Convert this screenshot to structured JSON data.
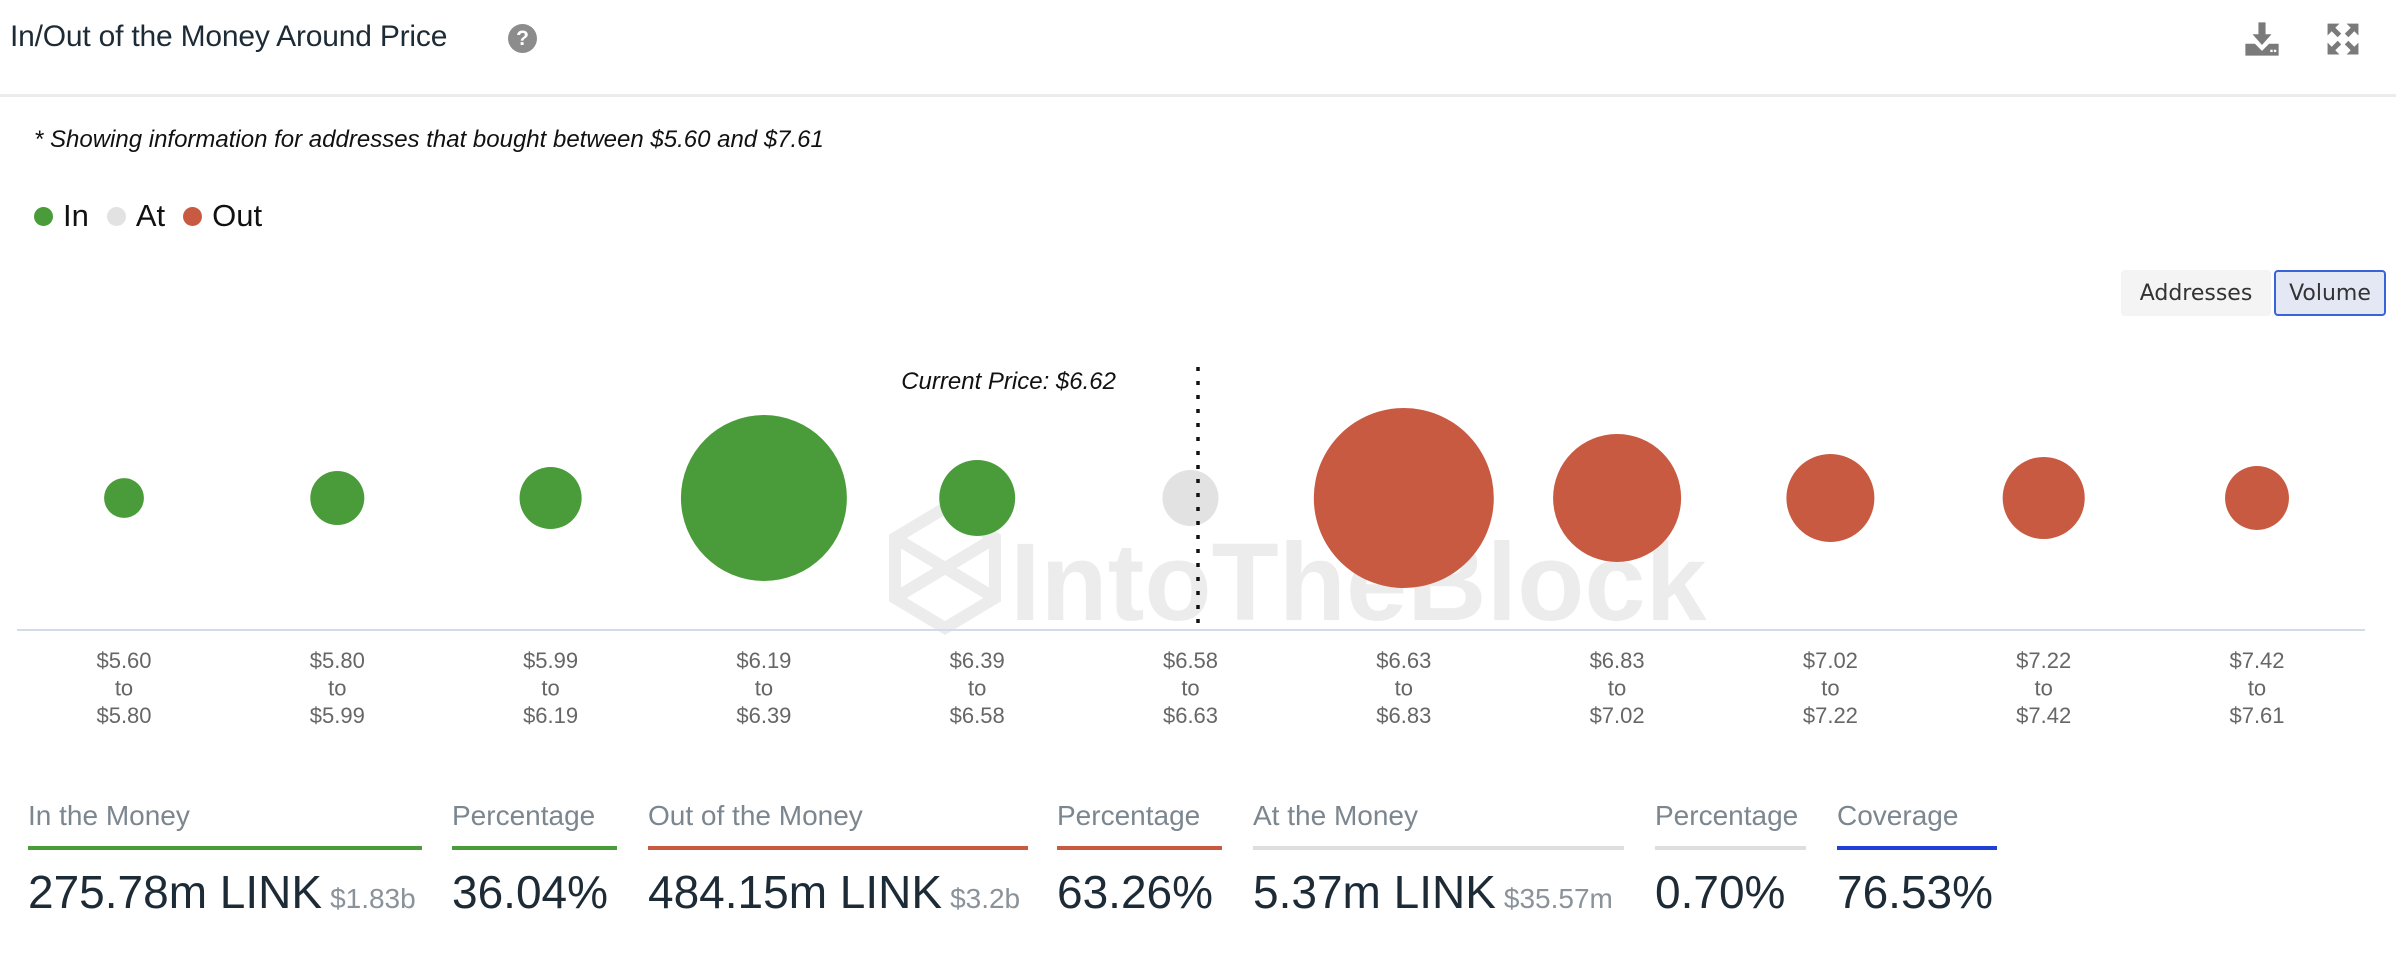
{
  "header": {
    "title": "In/Out of the Money Around Price",
    "help_icon": "question-circle-icon",
    "download_icon": "download-icon",
    "expand_icon": "expand-icon"
  },
  "note": "* Showing information for addresses that bought between $5.60 and $7.61",
  "legend": [
    {
      "label": "In",
      "color": "#4a9c3a"
    },
    {
      "label": "At",
      "color": "#e2e2e2"
    },
    {
      "label": "Out",
      "color": "#c95a42"
    }
  ],
  "toggle": {
    "options": [
      "Addresses",
      "Volume"
    ],
    "selected": "Volume"
  },
  "chart_data": {
    "type": "scatter",
    "subtype": "bubble",
    "title": "In/Out of the Money Around Price",
    "current_price_label": "Current Price: $6.62",
    "current_price": 6.62,
    "watermark": "IntoTheBlock",
    "categories": [
      {
        "from": "$5.60",
        "to": "$5.80"
      },
      {
        "from": "$5.80",
        "to": "$5.99"
      },
      {
        "from": "$5.99",
        "to": "$6.19"
      },
      {
        "from": "$6.19",
        "to": "$6.39"
      },
      {
        "from": "$6.39",
        "to": "$6.58"
      },
      {
        "from": "$6.58",
        "to": "$6.63"
      },
      {
        "from": "$6.63",
        "to": "$6.83"
      },
      {
        "from": "$6.83",
        "to": "$7.02"
      },
      {
        "from": "$7.02",
        "to": "$7.22"
      },
      {
        "from": "$7.22",
        "to": "$7.42"
      },
      {
        "from": "$7.42",
        "to": "$7.61"
      }
    ],
    "connector_word": "to",
    "status": [
      "In",
      "In",
      "In",
      "In",
      "In",
      "At",
      "Out",
      "Out",
      "Out",
      "Out",
      "Out"
    ],
    "relative_volume": [
      0.049,
      0.09,
      0.119,
      0.85,
      0.178,
      0.097,
      1.0,
      0.506,
      0.239,
      0.208,
      0.126
    ],
    "current_price_position": "between $6.58-$6.63 bucket",
    "colors": {
      "In": "#4a9c3a",
      "At": "#e2e2e2",
      "Out": "#c95a42"
    },
    "xlabel": "",
    "ylabel": ""
  },
  "stats": [
    {
      "label": "In the Money",
      "value": "275.78m LINK",
      "sub": "$1.83b",
      "color": "#4a9c3a"
    },
    {
      "label": "Percentage",
      "value": "36.04%",
      "sub": "",
      "color": "#4a9c3a"
    },
    {
      "label": "Out of the Money",
      "value": "484.15m LINK",
      "sub": "$3.2b",
      "color": "#c95a42"
    },
    {
      "label": "Percentage",
      "value": "63.26%",
      "sub": "",
      "color": "#c95a42"
    },
    {
      "label": "At the Money",
      "value": "5.37m LINK",
      "sub": "$35.57m",
      "color": "#dedede"
    },
    {
      "label": "Percentage",
      "value": "0.70%",
      "sub": "",
      "color": "#dedede"
    },
    {
      "label": "Coverage",
      "value": "76.53%",
      "sub": "",
      "color": "#1f3fd8"
    }
  ]
}
